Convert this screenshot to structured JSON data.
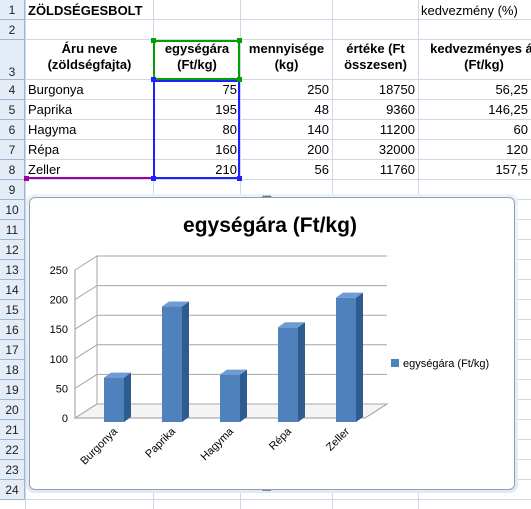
{
  "sheet": {
    "title": "ZÖLDSÉGESBOLT",
    "discount_label": "kedvezmény (%)",
    "row_numbers": [
      "1",
      "2",
      "3",
      "4",
      "5",
      "6",
      "7",
      "8",
      "9",
      "10",
      "11",
      "12",
      "13",
      "14",
      "15",
      "16",
      "17",
      "18",
      "19",
      "20",
      "21",
      "22",
      "23",
      "24"
    ],
    "headers": {
      "a": "Áru neve (zöldségfajta)",
      "b": "egységára (Ft/kg)",
      "c": "mennyisége (kg)",
      "d": "értéke (Ft összesen)",
      "e": "kedvezményes ár (Ft/kg)"
    },
    "rows": [
      {
        "name": "Burgonya",
        "price": "75",
        "qty": "250",
        "value": "18750",
        "disc": "56,25"
      },
      {
        "name": "Paprika",
        "price": "195",
        "qty": "48",
        "value": "9360",
        "disc": "146,25"
      },
      {
        "name": "Hagyma",
        "price": "80",
        "qty": "140",
        "value": "11200",
        "disc": "60"
      },
      {
        "name": "Répa",
        "price": "160",
        "qty": "200",
        "value": "32000",
        "disc": "120"
      },
      {
        "name": "Zeller",
        "price": "210",
        "qty": "56",
        "value": "11760",
        "disc": "157,5"
      }
    ]
  },
  "colors": {
    "bar_front": "#4f81bd",
    "bar_side": "#2f5c8f",
    "bar_top": "#6f9bd4",
    "selection_green": "#00a000",
    "selection_blue": "#0000ff",
    "selection_purple": "#a000a0"
  },
  "chart_data": {
    "type": "bar",
    "title": "egységára (Ft/kg)",
    "categories": [
      "Burgonya",
      "Paprika",
      "Hagyma",
      "Répa",
      "Zeller"
    ],
    "series": [
      {
        "name": "egységára (Ft/kg)",
        "values": [
          75,
          195,
          80,
          160,
          210
        ]
      }
    ],
    "yticks": [
      "0",
      "50",
      "100",
      "150",
      "200",
      "250"
    ],
    "ylim": [
      0,
      250
    ],
    "grid": true,
    "legend_position": "right",
    "three_d": true
  }
}
